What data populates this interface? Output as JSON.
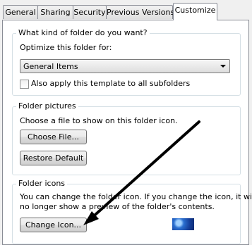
{
  "tabs": [
    {
      "label": "General",
      "active": false
    },
    {
      "label": "Sharing",
      "active": false
    },
    {
      "label": "Security",
      "active": false
    },
    {
      "label": "Previous Versions",
      "active": false
    },
    {
      "label": "Customize",
      "active": true
    }
  ],
  "folder_type": {
    "title": "What kind of folder do you want?",
    "optimize_label": "Optimize this folder for:",
    "selected_option": "General Items",
    "apply_subfolders_label": "Also apply this template to all subfolders",
    "apply_subfolders_checked": false
  },
  "folder_pictures": {
    "title": "Folder pictures",
    "description": "Choose a file to show on this folder icon.",
    "choose_file_label": "Choose File...",
    "restore_default_label": "Restore Default"
  },
  "folder_icons": {
    "title": "Folder icons",
    "description_line1": "You can change the folder icon. If you change the icon, it will",
    "description_line2": "no longer show a preview of the folder's contents.",
    "change_icon_label": "Change Icon..."
  },
  "colors": {
    "tab_border": "#898c95",
    "group_border": "#d5dfe5",
    "arrow": "#000000"
  }
}
